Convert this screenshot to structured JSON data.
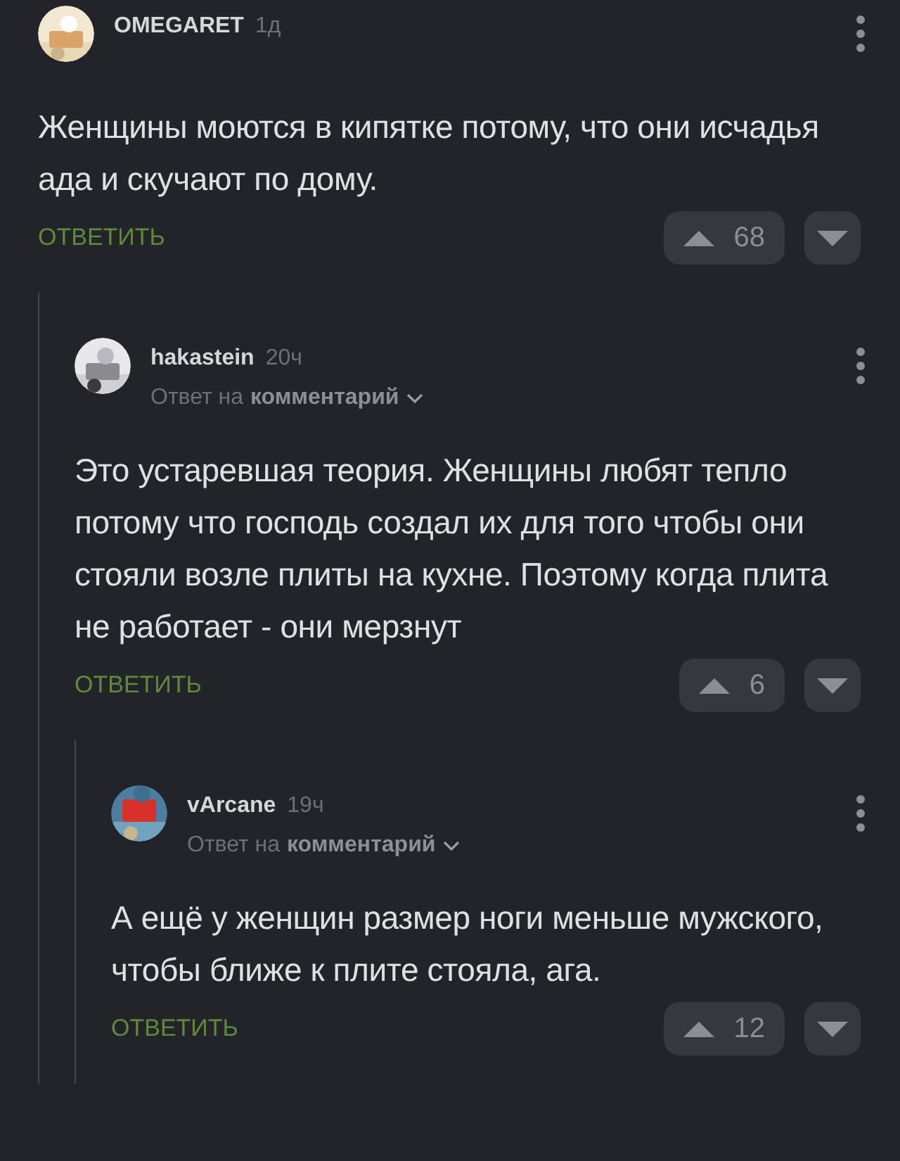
{
  "comments": [
    {
      "author": "OMEGARET",
      "time": "1д",
      "text": "Женщины моются в кипятке потому, что они исчадья ада и скучают по дому.",
      "reply": "ОТВЕТИТЬ",
      "votes": "68",
      "children": [
        {
          "author": "hakastein",
          "time": "20ч",
          "reply_to": {
            "prefix": "Ответ на",
            "target": "комментарий"
          },
          "text": "Это устаревшая теория. Женщины любят тепло потому что господь создал их для того чтобы они стояли возле плиты на кухне. Поэтому когда плита не работает - они мерзнут",
          "reply": "ОТВЕТИТЬ",
          "votes": "6",
          "children": [
            {
              "author": "vArcane",
              "time": "19ч",
              "reply_to": {
                "prefix": "Ответ на",
                "target": "комментарий"
              },
              "text": "А ещё у женщин размер ноги меньше мужского, чтобы ближе к плите стояла, ага.",
              "reply": "ОТВЕТИТЬ",
              "votes": "12"
            }
          ]
        }
      ]
    }
  ]
}
